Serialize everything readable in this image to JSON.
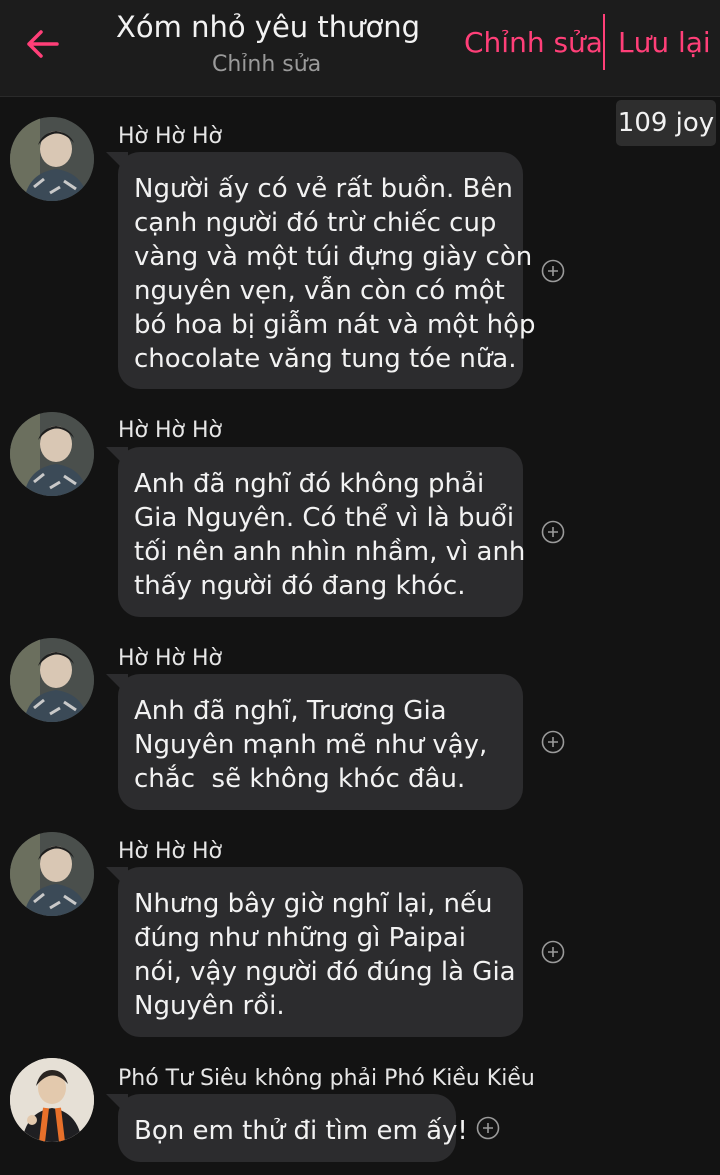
{
  "header": {
    "title": "Xóm nhỏ yêu thương",
    "subtitle": "Chỉnh sửa",
    "edit_label": "Chỉnh sửa",
    "save_label": "Lưu lại",
    "back_icon": "arrow-left-icon",
    "accent": "#ff3f78"
  },
  "joy_badge": "109 joy",
  "messages": [
    {
      "sender": "Hờ Hờ Hờ",
      "lines": [
        "Người ấy có vẻ rất buồn. Bên",
        "cạnh người đó trừ chiếc cup",
        "vàng và một túi đựng giày còn",
        "nguyên vẹn, vẫn còn có một",
        "bó hoa bị giẫm nát và một hộp",
        "chocolate văng tung tóe nữa."
      ]
    },
    {
      "sender": "Hờ Hờ Hờ",
      "lines": [
        "Anh đã nghĩ đó không phải",
        "Gia Nguyên. Có thể vì là buổi",
        "tối nên anh nhìn nhầm, vì anh",
        "thấy người đó đang khóc."
      ]
    },
    {
      "sender": "Hờ Hờ Hờ",
      "lines": [
        "Anh đã nghĩ, Trương Gia",
        "Nguyên mạnh mẽ như vậy,",
        "chắc  sẽ không khóc đâu."
      ]
    },
    {
      "sender": "Hờ Hờ Hờ",
      "lines": [
        "Nhưng bây giờ nghĩ lại, nếu",
        "đúng như những gì Paipai",
        "nói, vậy người đó đúng là Gia",
        "Nguyên rồi."
      ]
    },
    {
      "sender": "Phó Tư Siêu không phải Phó Kiều Kiều",
      "lines": [
        "Bọn em thử đi tìm em ấy!"
      ]
    }
  ]
}
